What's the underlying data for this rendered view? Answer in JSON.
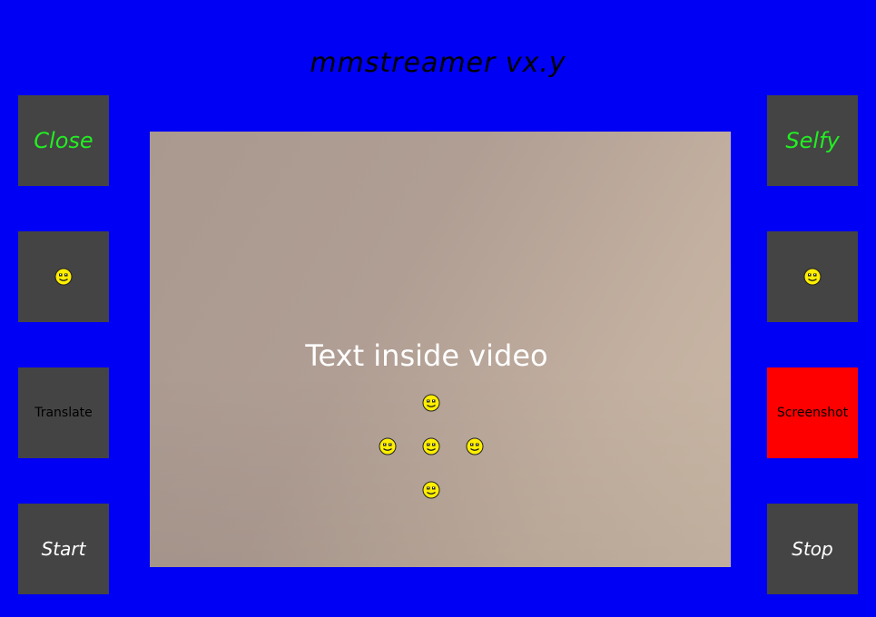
{
  "app": {
    "title": "mmstreamer vx.y"
  },
  "buttons": {
    "close": "Close",
    "selfy": "Selfy",
    "translate": "Translate",
    "screenshot": "Screenshot",
    "start": "Start",
    "stop": "Stop"
  },
  "video": {
    "overlay_text": "Text inside video"
  },
  "icons": {
    "left_smiley": "smiley-icon",
    "right_smiley": "smiley-icon",
    "dpad": [
      "smiley-icon",
      "smiley-icon",
      "smiley-icon",
      "smiley-icon",
      "smiley-icon"
    ]
  },
  "colors": {
    "background": "#0000f5",
    "button": "#444444",
    "screenshot_button": "#ff0000",
    "green_label": "#22ee22"
  }
}
